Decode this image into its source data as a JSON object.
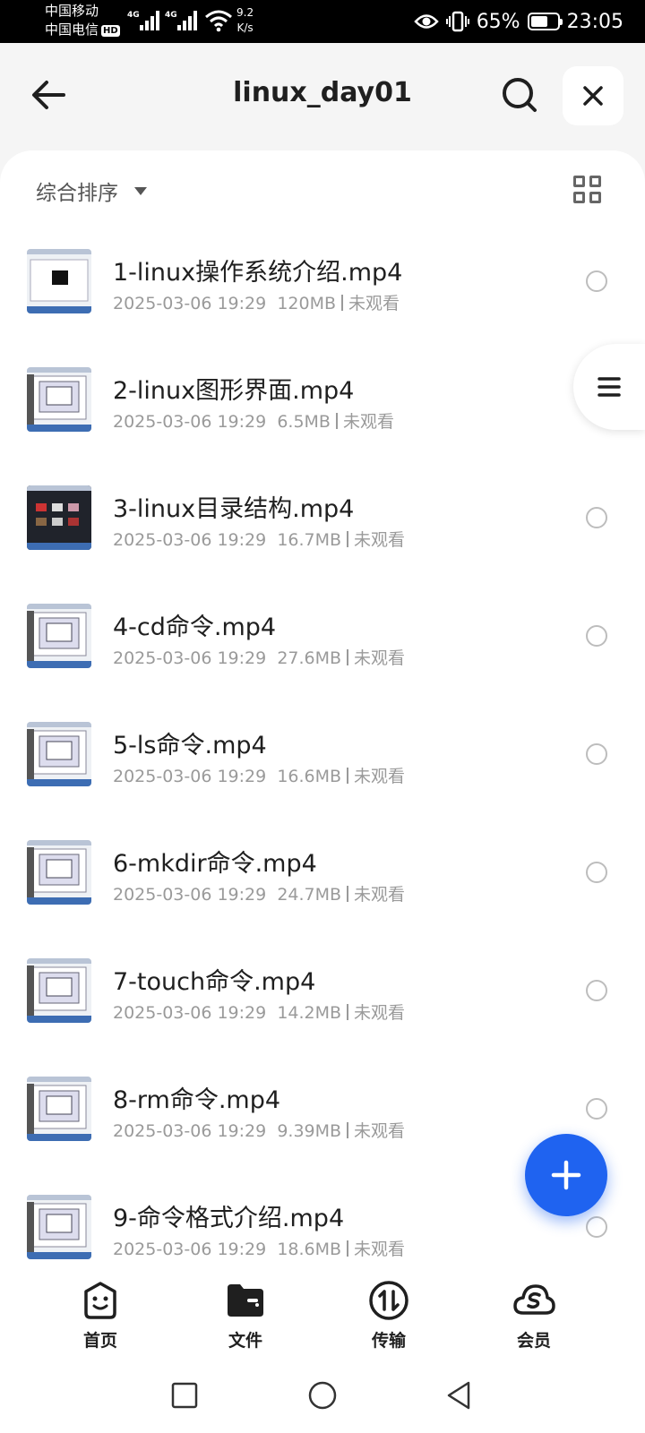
{
  "status_bar": {
    "carrier1": "中国移动",
    "carrier2": "中国电信",
    "hd_badge": "HD",
    "net_type1": "4G",
    "net_type2": "4G",
    "net_speed_value": "9.2",
    "net_speed_unit": "K/s",
    "battery_percent": "65%",
    "battery_level": 0.65,
    "time": "23:05",
    "icons": [
      "signal-icon",
      "wifi-icon",
      "eye-icon",
      "vibrate-icon",
      "battery-icon"
    ]
  },
  "header": {
    "title": "linux_day01",
    "back_icon": "arrow-left-icon",
    "search_icon": "search-icon",
    "close_icon": "close-icon"
  },
  "toolbar": {
    "sort_label": "综合排序",
    "grid_icon": "grid-view-icon"
  },
  "files": [
    {
      "name": "1-linux操作系统介绍.mp4",
      "date": "2025-03-06 19:29",
      "size": "120MB",
      "status": "未观看",
      "thumb": "dark"
    },
    {
      "name": "2-linux图形界面.mp4",
      "date": "2025-03-06 19:29",
      "size": "6.5MB",
      "status": "未观看",
      "thumb": "light"
    },
    {
      "name": "3-linux目录结构.mp4",
      "date": "2025-03-06 19:29",
      "size": "16.7MB",
      "status": "未观看",
      "thumb": "black"
    },
    {
      "name": "4-cd命令.mp4",
      "date": "2025-03-06 19:29",
      "size": "27.6MB",
      "status": "未观看",
      "thumb": "light"
    },
    {
      "name": "5-ls命令.mp4",
      "date": "2025-03-06 19:29",
      "size": "16.6MB",
      "status": "未观看",
      "thumb": "light"
    },
    {
      "name": "6-mkdir命令.mp4",
      "date": "2025-03-06 19:29",
      "size": "24.7MB",
      "status": "未观看",
      "thumb": "light"
    },
    {
      "name": "7-touch命令.mp4",
      "date": "2025-03-06 19:29",
      "size": "14.2MB",
      "status": "未观看",
      "thumb": "light"
    },
    {
      "name": "8-rm命令.mp4",
      "date": "2025-03-06 19:29",
      "size": "9.39MB",
      "status": "未观看",
      "thumb": "light"
    },
    {
      "name": "9-命令格式介绍.mp4",
      "date": "2025-03-06 19:29",
      "size": "18.6MB",
      "status": "未观看",
      "thumb": "light"
    }
  ],
  "bottom_nav": [
    {
      "label": "首页",
      "icon": "home-smile-icon"
    },
    {
      "label": "文件",
      "icon": "folder-icon",
      "active": true
    },
    {
      "label": "传输",
      "icon": "transfer-icon"
    },
    {
      "label": "会员",
      "icon": "vip-cloud-icon"
    }
  ],
  "colors": {
    "accent": "#1f63f0",
    "text": "#1f1f1f",
    "muted": "#9a9a9a"
  }
}
